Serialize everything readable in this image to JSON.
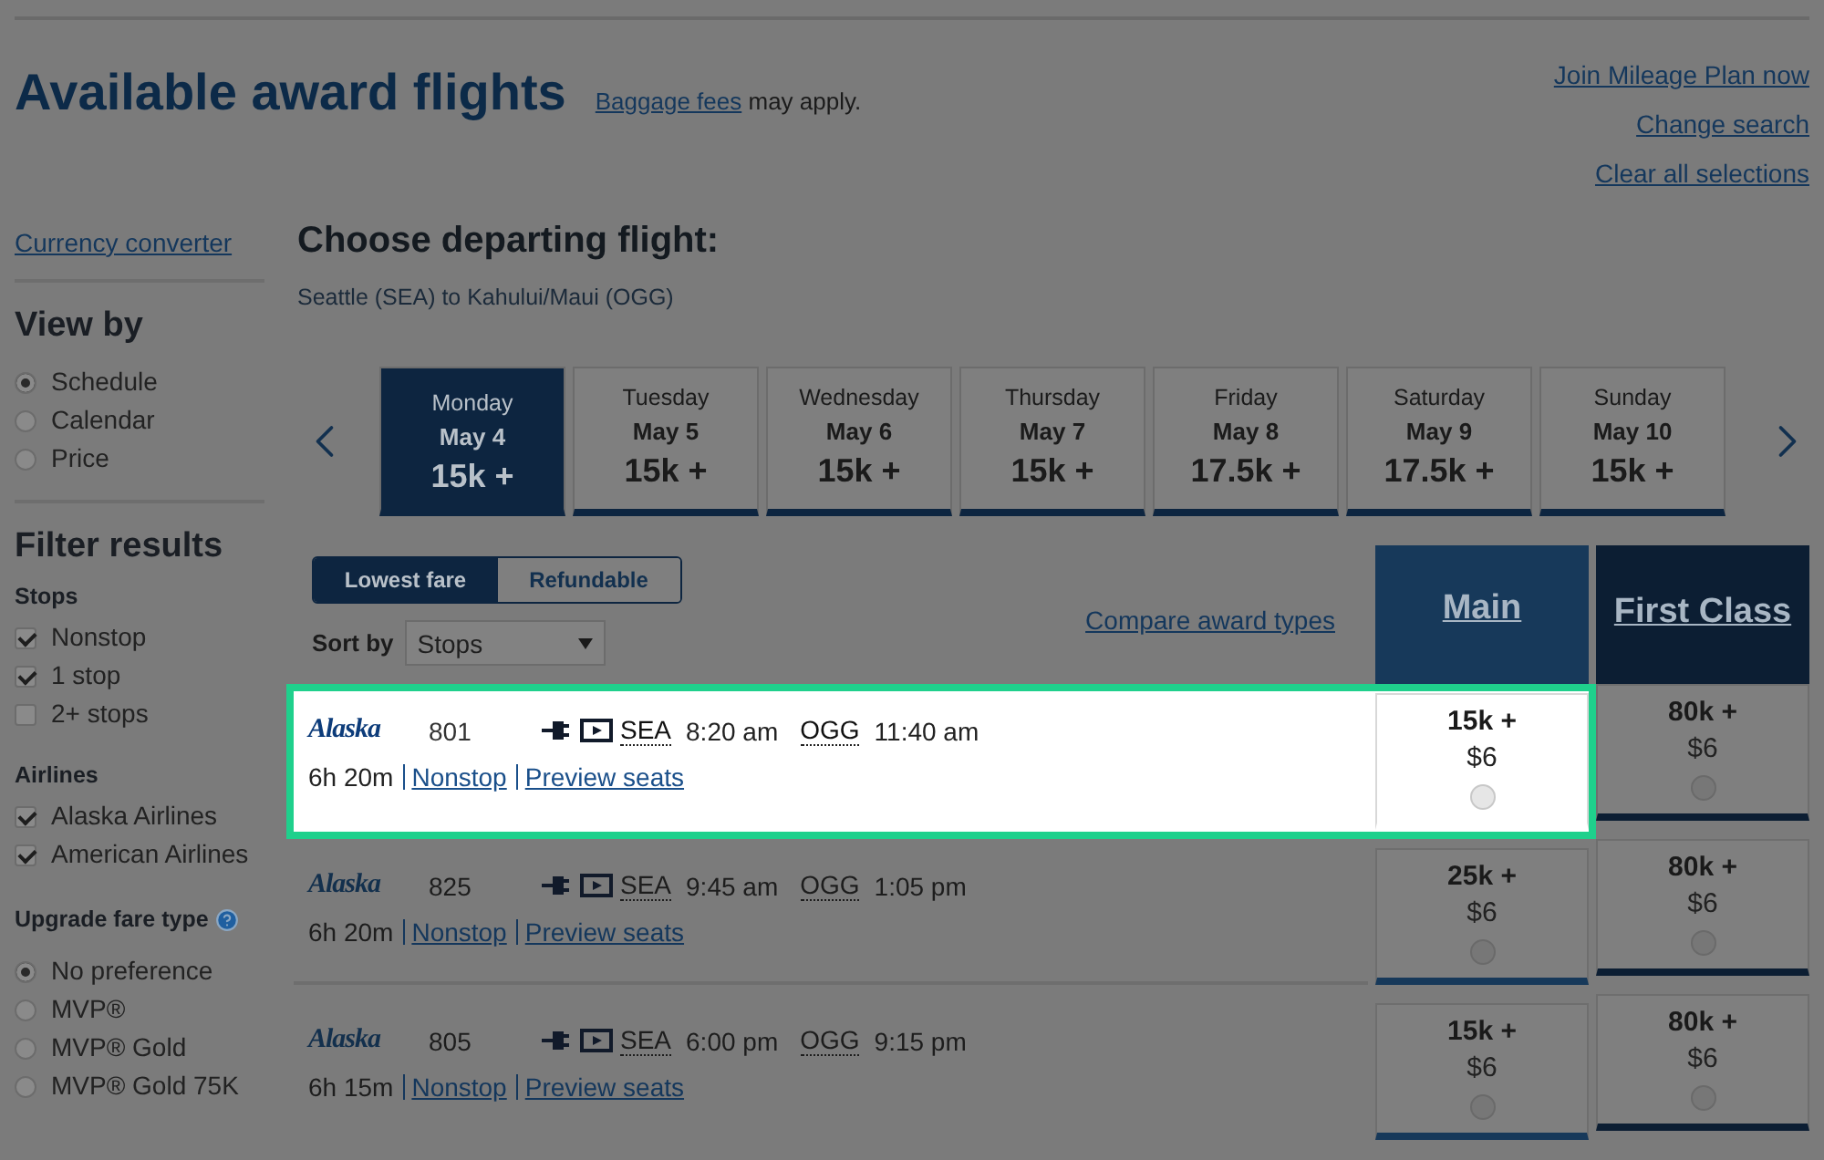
{
  "header": {
    "title": "Available award flights",
    "baggage_link": "Baggage fees",
    "baggage_suffix": "may apply.",
    "links": [
      "Join Mileage Plan now",
      "Change search",
      "Clear all selections"
    ]
  },
  "sidebar": {
    "currency_link": "Currency converter",
    "view_by": {
      "title": "View by",
      "options": [
        {
          "label": "Schedule",
          "selected": true
        },
        {
          "label": "Calendar",
          "selected": false
        },
        {
          "label": "Price",
          "selected": false
        }
      ]
    },
    "filter_title": "Filter results",
    "stops": {
      "title": "Stops",
      "options": [
        {
          "label": "Nonstop",
          "checked": true
        },
        {
          "label": "1 stop",
          "checked": true
        },
        {
          "label": "2+ stops",
          "checked": false
        }
      ]
    },
    "airlines": {
      "title": "Airlines",
      "options": [
        {
          "label": "Alaska Airlines",
          "checked": true
        },
        {
          "label": "American Airlines",
          "checked": true
        }
      ]
    },
    "upgrade": {
      "title": "Upgrade fare type",
      "options": [
        {
          "label": "No preference",
          "selected": true
        },
        {
          "label": "MVP®",
          "selected": false
        },
        {
          "label": "MVP® Gold",
          "selected": false
        },
        {
          "label": "MVP® Gold 75K",
          "selected": false
        }
      ]
    }
  },
  "main": {
    "title": "Choose departing flight:",
    "route": "Seattle (SEA) to Kahului/Maui (OGG)",
    "dates": [
      {
        "day": "Monday",
        "date": "May 4",
        "price": "15k +",
        "selected": true
      },
      {
        "day": "Tuesday",
        "date": "May 5",
        "price": "15k +",
        "selected": false
      },
      {
        "day": "Wednesday",
        "date": "May 6",
        "price": "15k +",
        "selected": false
      },
      {
        "day": "Thursday",
        "date": "May 7",
        "price": "15k +",
        "selected": false
      },
      {
        "day": "Friday",
        "date": "May 8",
        "price": "17.5k +",
        "selected": false
      },
      {
        "day": "Saturday",
        "date": "May 9",
        "price": "17.5k +",
        "selected": false
      },
      {
        "day": "Sunday",
        "date": "May 10",
        "price": "15k +",
        "selected": false
      }
    ],
    "fare_toggle": [
      {
        "label": "Lowest fare",
        "selected": true
      },
      {
        "label": "Refundable",
        "selected": false
      }
    ],
    "sort": {
      "label": "Sort by",
      "value": "Stops"
    },
    "compare_link": "Compare award types",
    "fare_columns": [
      {
        "label": "Main",
        "kind": "main"
      },
      {
        "label": "First Class",
        "kind": "first"
      }
    ],
    "flights": [
      {
        "airline": "Alaska",
        "number": "801",
        "origin": "SEA",
        "depart": "8:20 am",
        "dest": "OGG",
        "arrive": "11:40 am",
        "duration": "6h 20m",
        "stops": "Nonstop",
        "preview": "Preview seats",
        "highlighted": true,
        "fares": [
          {
            "miles": "15k +",
            "tax": "$6",
            "selected": false
          },
          {
            "miles": "80k +",
            "tax": "$6",
            "selected": false
          }
        ]
      },
      {
        "airline": "Alaska",
        "number": "825",
        "origin": "SEA",
        "depart": "9:45 am",
        "dest": "OGG",
        "arrive": "1:05 pm",
        "duration": "6h 20m",
        "stops": "Nonstop",
        "preview": "Preview seats",
        "highlighted": false,
        "fares": [
          {
            "miles": "25k +",
            "tax": "$6",
            "selected": false
          },
          {
            "miles": "80k +",
            "tax": "$6",
            "selected": false
          }
        ]
      },
      {
        "airline": "Alaska",
        "number": "805",
        "origin": "SEA",
        "depart": "6:00 pm",
        "dest": "OGG",
        "arrive": "9:15 pm",
        "duration": "6h 15m",
        "stops": "Nonstop",
        "preview": "Preview seats",
        "highlighted": false,
        "fares": [
          {
            "miles": "15k +",
            "tax": "$6",
            "selected": false
          },
          {
            "miles": "80k +",
            "tax": "$6",
            "selected": false
          }
        ]
      }
    ]
  }
}
